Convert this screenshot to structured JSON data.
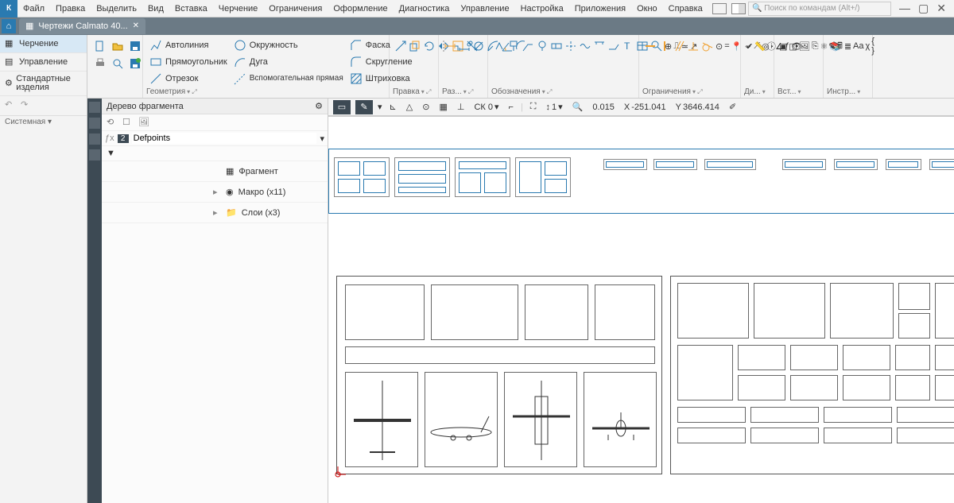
{
  "menu": [
    "Файл",
    "Правка",
    "Выделить",
    "Вид",
    "Вставка",
    "Черчение",
    "Ограничения",
    "Оформление",
    "Диагностика",
    "Управление",
    "Настройка",
    "Приложения",
    "Окно",
    "Справка"
  ],
  "search_placeholder": "Поиск по командам (Alt+/)",
  "tab_title": "Чертежи Calmato 40...",
  "left_nav": {
    "drafting": "Черчение",
    "management": "Управление",
    "std_parts": "Стандартные изделия",
    "system": "Системная"
  },
  "ribbon": {
    "autoline": "Автолиния",
    "rect": "Прямоугольник",
    "segment": "Отрезок",
    "circle": "Окружность",
    "arc": "Дуга",
    "aux_line": "Вспомогательная прямая",
    "chamfer": "Фаска",
    "fillet": "Скругление",
    "hatch": "Штриховка",
    "geometry": "Геометрия",
    "edit": "Правка",
    "dims": "Раз...",
    "annotations": "Обозначения",
    "constraints": "Ограничения",
    "diag": "Ди...",
    "insert": "Вст...",
    "tools": "Инстр..."
  },
  "tree": {
    "title": "Дерево фрагмента",
    "layer_name": "Defpoints",
    "layer_index": "2",
    "fragment": "Фрагмент",
    "macro": "Макро (x11)",
    "layers": "Слои (x3)"
  },
  "propbar": {
    "cs": "СК 0",
    "scale": "1",
    "step": "0.015",
    "x_label": "X",
    "x_val": "-251.041",
    "y_label": "Y",
    "y_val": "3646.414"
  }
}
